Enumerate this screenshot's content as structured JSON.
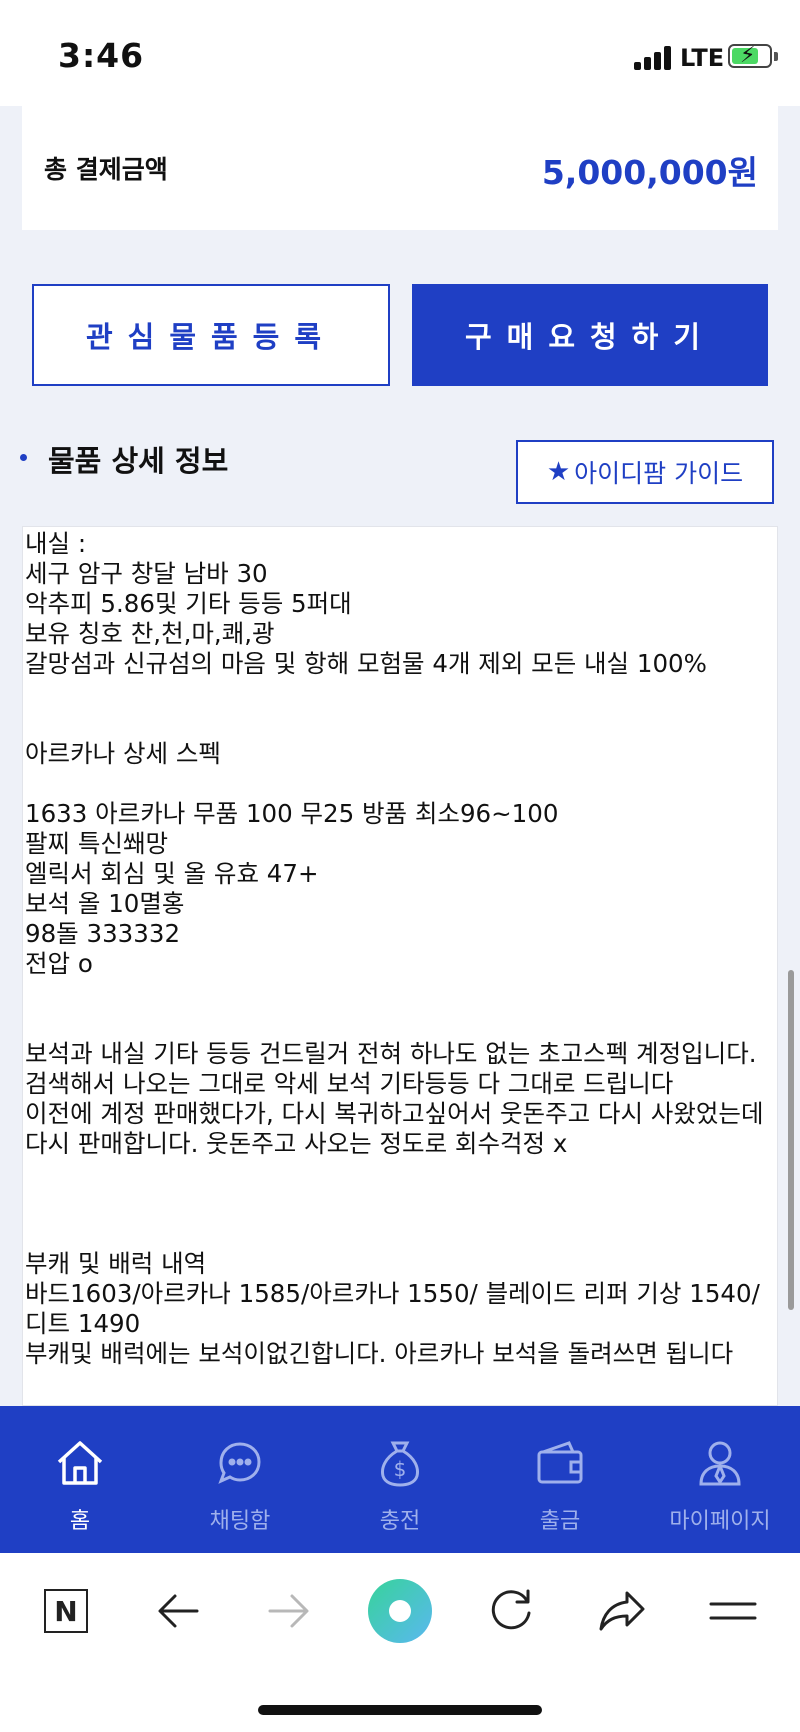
{
  "status": {
    "time": "3:46",
    "network": "LTE"
  },
  "payment": {
    "label": "총 결제금액",
    "amount": "5,000,000원"
  },
  "actions": {
    "wishlist": "관심물품등록",
    "purchase": "구매요청하기"
  },
  "section": {
    "title": "물품 상세 정보",
    "guide_button": "아이디팜 가이드"
  },
  "detail": {
    "text": "내실 :\n세구 암구 창달 남바 30\n악추피 5.86및 기타 등등 5퍼대\n보유 칭호 찬,천,마,쾌,광\n갈망섬과 신규섬의 마음 및 항해 모험물 4개 제외 모든 내실 100%\n\n\n아르카나 상세 스펙\n\n1633 아르카나 무품 100 무25 방품 최소96~100\n팔찌 특신쐐망\n엘릭서 회심 및 올 유효 47+\n보석 올 10멸홍\n98돌 333332\n전압 o\n\n\n보석과 내실 기타 등등 건드릴거 전혀 하나도 없는 초고스펙 계정입니다.\n검색해서 나오는 그대로 악세 보석 기타등등 다 그대로 드립니다\n이전에 계정 판매했다가, 다시 복귀하고싶어서 웃돈주고 다시 사왔었는데\n다시 판매합니다. 웃돈주고 사오는 정도로 회수걱정 x\n\n\n\n부캐 및 배럭 내역\n바드1603/아르카나 1585/아르카나 1550/ 블레이드 리퍼 기상 1540/ 디트 1490\n부캐및 배럭에는 보석이없긴합니다. 아르카나 보석을 돌려쓰면 됩니다"
  },
  "tabs": [
    {
      "label": "홈",
      "icon": "home-icon",
      "active": true
    },
    {
      "label": "채팅함",
      "icon": "chat-icon",
      "active": false
    },
    {
      "label": "충전",
      "icon": "money-bag-icon",
      "active": false
    },
    {
      "label": "출금",
      "icon": "wallet-icon",
      "active": false
    },
    {
      "label": "마이페이지",
      "icon": "user-icon",
      "active": false
    }
  ],
  "browser": {
    "logo": "N"
  },
  "colors": {
    "primary": "#1f3fc4",
    "background": "#eef1f8",
    "inactive_tab": "#9fb0ec"
  }
}
